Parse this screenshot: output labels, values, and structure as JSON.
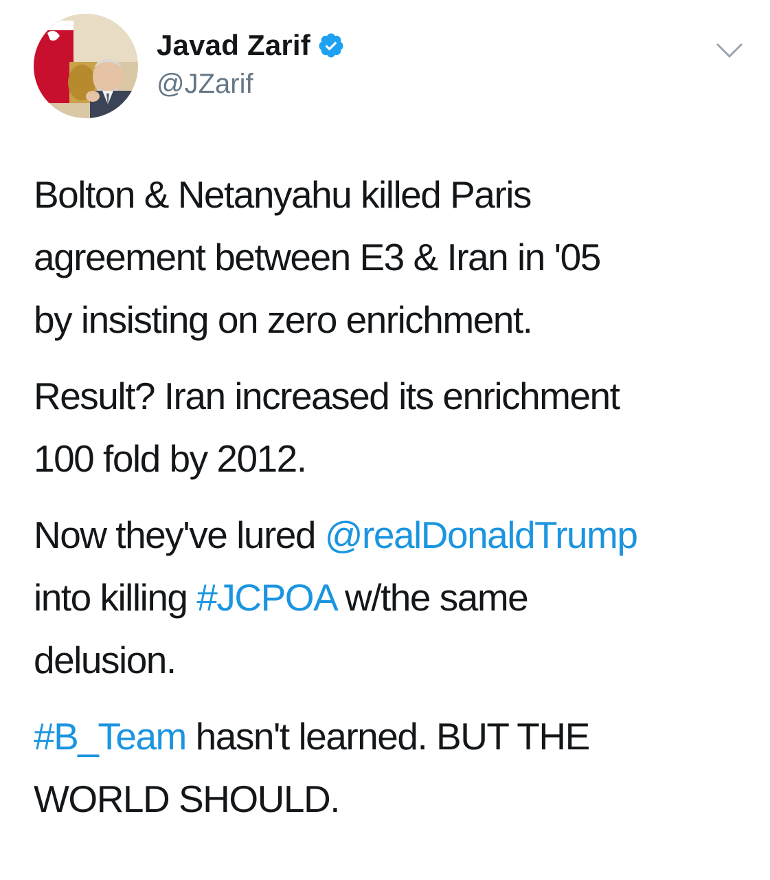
{
  "tweet": {
    "author": {
      "name": "Javad Zarif",
      "handle": "@JZarif",
      "verified": true,
      "avatar_icon": "profile-photo"
    },
    "menu_icon": "chevron-down-icon",
    "paragraphs": [
      {
        "lines": [
          [
            {
              "text": "Bolton & Netanyahu killed Paris"
            }
          ],
          [
            {
              "text": "agreement between E3 & Iran in '05"
            }
          ],
          [
            {
              "text": "by insisting on zero enrichment."
            }
          ]
        ]
      },
      {
        "lines": [
          [
            {
              "text": "Result? Iran increased its enrichment"
            }
          ],
          [
            {
              "text": "100 fold by 2012."
            }
          ]
        ]
      },
      {
        "lines": [
          [
            {
              "text": "Now they've lured "
            },
            {
              "text": "@realDonaldTrump",
              "link": true
            }
          ],
          [
            {
              "text": "into killing "
            },
            {
              "text": "#JCPOA",
              "link": true
            },
            {
              "text": " w/the same"
            }
          ],
          [
            {
              "text": "delusion."
            }
          ]
        ]
      },
      {
        "lines": [
          [
            {
              "text": "#B_Team",
              "link": true
            },
            {
              "text": " hasn't learned. BUT THE"
            }
          ],
          [
            {
              "text": "WORLD SHOULD."
            }
          ]
        ]
      }
    ]
  },
  "colors": {
    "link": "#1b95e0",
    "verified_badge": "#1da1f2",
    "text": "#14171a",
    "secondary": "#657786"
  }
}
